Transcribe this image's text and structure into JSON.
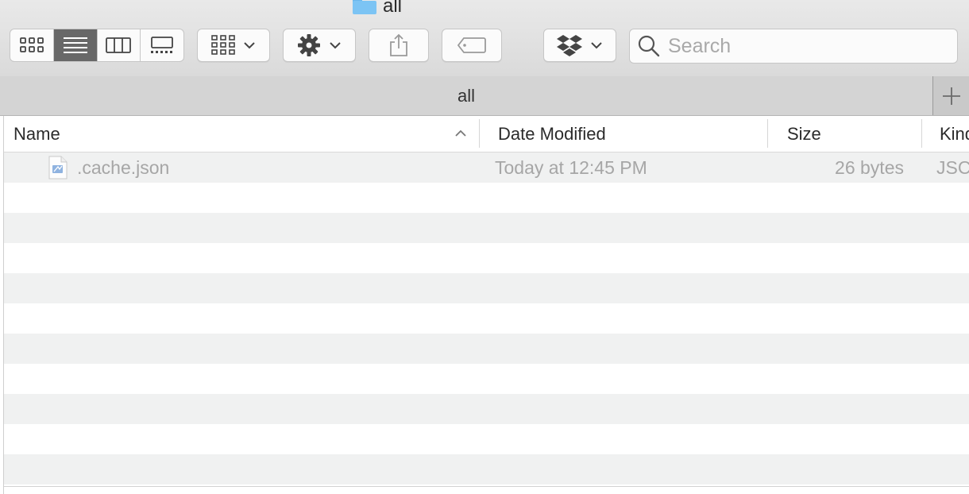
{
  "window": {
    "title": "all",
    "icon": "folder-icon"
  },
  "toolbar": {
    "view_modes": [
      {
        "name": "icon-view",
        "icon": "grid-icon",
        "active": false
      },
      {
        "name": "list-view",
        "icon": "list-icon",
        "active": true
      },
      {
        "name": "column-view",
        "icon": "columns-icon",
        "active": false
      },
      {
        "name": "gallery-view",
        "icon": "gallery-icon",
        "active": false
      }
    ],
    "group_icon": "group-icon",
    "action_icon": "gear-icon",
    "share_icon": "share-icon",
    "tag_icon": "tag-icon",
    "dropbox_icon": "dropbox-icon",
    "search_placeholder": "Search"
  },
  "tabs": {
    "items": [
      {
        "label": "all"
      }
    ],
    "add_icon": "plus-icon"
  },
  "list": {
    "columns": {
      "name": "Name",
      "date": "Date Modified",
      "size": "Size",
      "kind": "Kind"
    },
    "sort": {
      "column": "name",
      "direction": "ascending"
    },
    "rows": [
      {
        "name": ".cache.json",
        "date": "Today at 12:45 PM",
        "size": "26 bytes",
        "kind": "JSC",
        "icon": "json-file-icon"
      }
    ]
  },
  "colors": {
    "selected_view": "#686868",
    "stripe": "#f0f1f1",
    "dimmed_text": "#a6a6a6",
    "folder": "#7cc4f4"
  }
}
